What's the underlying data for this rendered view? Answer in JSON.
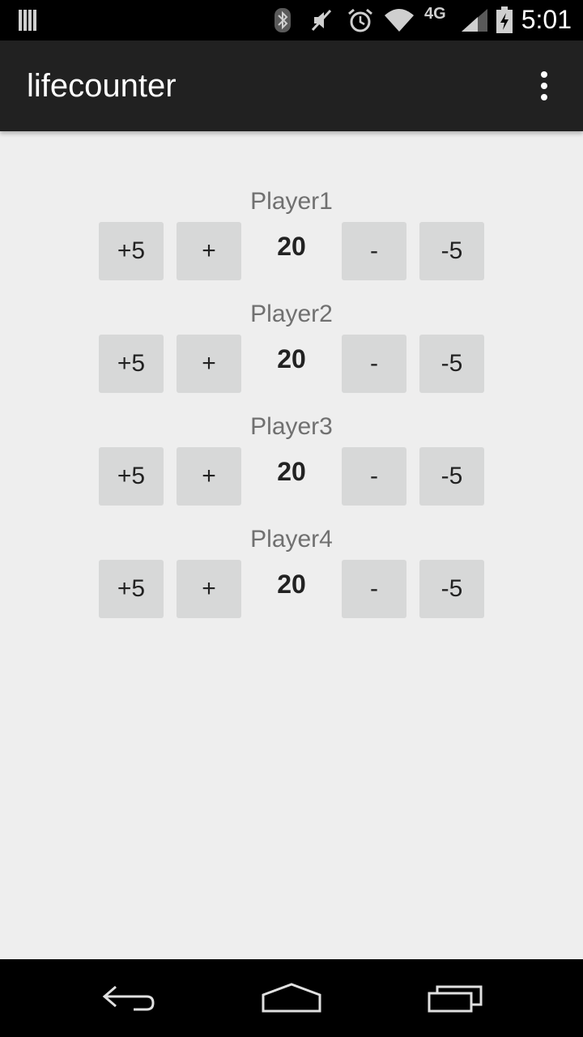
{
  "status_bar": {
    "time": "5:01",
    "network": "4G",
    "icons": [
      "notification-icon",
      "bluetooth-icon",
      "mute-icon",
      "alarm-icon",
      "wifi-icon",
      "signal-icon",
      "battery-icon"
    ]
  },
  "action_bar": {
    "title": "lifecounter",
    "overflow_icon": "more-vert-icon"
  },
  "players": [
    {
      "name": "Player1",
      "life": "20",
      "plus5": "+5",
      "plus1": "+",
      "minus1": "-",
      "minus5": "-5"
    },
    {
      "name": "Player2",
      "life": "20",
      "plus5": "+5",
      "plus1": "+",
      "minus1": "-",
      "minus5": "-5"
    },
    {
      "name": "Player3",
      "life": "20",
      "plus5": "+5",
      "plus1": "+",
      "minus1": "-",
      "minus5": "-5"
    },
    {
      "name": "Player4",
      "life": "20",
      "plus5": "+5",
      "plus1": "+",
      "minus1": "-",
      "minus5": "-5"
    }
  ],
  "nav_bar": {
    "icons": [
      "back-icon",
      "home-icon",
      "recent-apps-icon"
    ]
  },
  "colors": {
    "background": "#eeeeee",
    "action_bar": "#212121",
    "button": "#d7d8d8",
    "player_label": "#707070"
  }
}
